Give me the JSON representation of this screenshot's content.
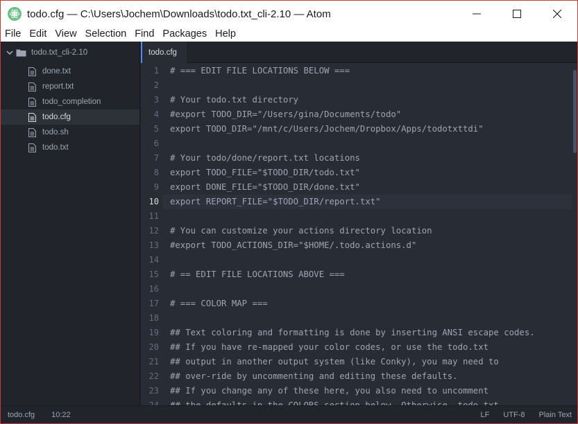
{
  "window": {
    "title": "todo.cfg — C:\\Users\\Jochem\\Downloads\\todo.txt_cli-2.10 — Atom",
    "controls": [
      "minimize-icon",
      "maximize-icon",
      "close-icon"
    ]
  },
  "menu": {
    "items": [
      {
        "label": "File"
      },
      {
        "label": "Edit"
      },
      {
        "label": "View"
      },
      {
        "label": "Selection"
      },
      {
        "label": "Find"
      },
      {
        "label": "Packages"
      },
      {
        "label": "Help"
      }
    ]
  },
  "tree": {
    "root": "todo.txt_cli-2.10",
    "files": [
      {
        "label": "done.txt"
      },
      {
        "label": "report.txt"
      },
      {
        "label": "todo_completion"
      },
      {
        "label": "todo.cfg",
        "selected": true
      },
      {
        "label": "todo.sh"
      },
      {
        "label": "todo.txt"
      }
    ]
  },
  "tabs": [
    {
      "label": "todo.cfg",
      "active": true
    }
  ],
  "editor": {
    "current_line": 10,
    "lines": [
      {
        "n": "1",
        "text": "# === EDIT FILE LOCATIONS BELOW ==="
      },
      {
        "n": "2",
        "text": ""
      },
      {
        "n": "3",
        "text": "# Your todo.txt directory"
      },
      {
        "n": "4",
        "text": "#export TODO_DIR=\"/Users/gina/Documents/todo\""
      },
      {
        "n": "5",
        "text": "export TODO_DIR=\"/mnt/c/Users/Jochem/Dropbox/Apps/todotxttdi\""
      },
      {
        "n": "6",
        "text": ""
      },
      {
        "n": "7",
        "text": "# Your todo/done/report.txt locations"
      },
      {
        "n": "8",
        "text": "export TODO_FILE=\"$TODO_DIR/todo.txt\""
      },
      {
        "n": "9",
        "text": "export DONE_FILE=\"$TODO_DIR/done.txt\""
      },
      {
        "n": "10",
        "text": "export REPORT_FILE=\"$TODO_DIR/report.txt\""
      },
      {
        "n": "11",
        "text": ""
      },
      {
        "n": "12",
        "text": "# You can customize your actions directory location"
      },
      {
        "n": "13",
        "text": "#export TODO_ACTIONS_DIR=\"$HOME/.todo.actions.d\""
      },
      {
        "n": "14",
        "text": ""
      },
      {
        "n": "15",
        "text": "# == EDIT FILE LOCATIONS ABOVE ==="
      },
      {
        "n": "16",
        "text": ""
      },
      {
        "n": "17",
        "text": "# === COLOR MAP ==="
      },
      {
        "n": "18",
        "text": ""
      },
      {
        "n": "19",
        "text": "## Text coloring and formatting is done by inserting ANSI escape codes."
      },
      {
        "n": "20",
        "text": "## If you have re-mapped your color codes, or use the todo.txt"
      },
      {
        "n": "21",
        "text": "## output in another output system (like Conky), you may need to"
      },
      {
        "n": "22",
        "text": "## over-ride by uncommenting and editing these defaults."
      },
      {
        "n": "23",
        "text": "## If you change any of these here, you also need to uncomment"
      },
      {
        "n": "24",
        "text": "## the defaults in the COLORS section below. Otherwise, todo.txt"
      }
    ]
  },
  "status": {
    "file": "todo.cfg",
    "cursor": "10:22",
    "line_ending": "LF",
    "encoding": "UTF-8",
    "grammar": "Plain Text"
  },
  "colors": {
    "accent": "#568af2",
    "editor_bg": "#282c34",
    "panel_bg": "#21252b",
    "window_border": "#c63b34"
  }
}
